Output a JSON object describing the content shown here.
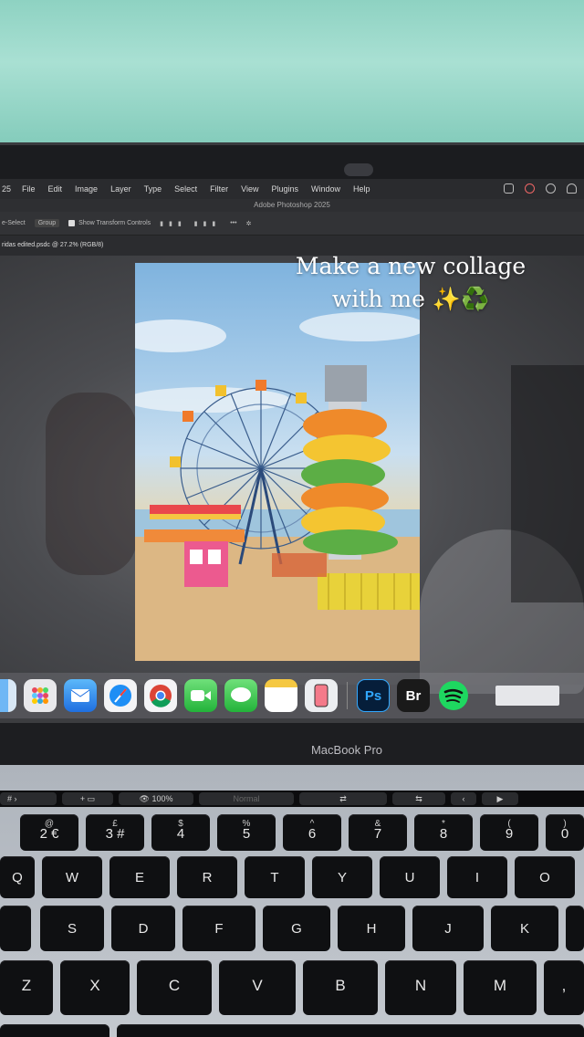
{
  "menubar": {
    "app_short": "25",
    "items": [
      "File",
      "Edit",
      "Image",
      "Layer",
      "Type",
      "Select",
      "Filter",
      "View",
      "Plugins",
      "Window",
      "Help"
    ]
  },
  "app_title": "Adobe Photoshop 2025",
  "options_bar": {
    "autoselect": "e-Select",
    "group": "Group",
    "transform": "Show Transform Controls",
    "more": "•••"
  },
  "document_tab": "ridas edited.psdc @ 27.2% (RGB/8)",
  "caption": {
    "line1": "Make a new collage",
    "line2": "with me ✨♻️"
  },
  "dock": {
    "apps": [
      {
        "name": "finder",
        "label": ""
      },
      {
        "name": "launchpad",
        "label": ""
      },
      {
        "name": "mail",
        "label": ""
      },
      {
        "name": "safari",
        "label": ""
      },
      {
        "name": "chrome",
        "label": ""
      },
      {
        "name": "facetime",
        "label": ""
      },
      {
        "name": "messages",
        "label": ""
      },
      {
        "name": "notes",
        "label": ""
      },
      {
        "name": "iphone-mirroring",
        "label": ""
      },
      {
        "name": "photoshop",
        "label": "Ps"
      },
      {
        "name": "bridge",
        "label": "Br"
      },
      {
        "name": "spotify",
        "label": ""
      }
    ]
  },
  "laptop_brand": "MacBook Pro",
  "touchbar": {
    "item1": "#",
    "item2": "+",
    "zoom": "100%",
    "blend": "Normal"
  },
  "keyboard": {
    "number_row": [
      {
        "top": "@",
        "main": "2 €"
      },
      {
        "top": "£",
        "main": "3 #"
      },
      {
        "top": "$",
        "main": "4"
      },
      {
        "top": "%",
        "main": "5"
      },
      {
        "top": "^",
        "main": "6"
      },
      {
        "top": "&",
        "main": "7"
      },
      {
        "top": "*",
        "main": "8"
      },
      {
        "top": "(",
        "main": "9"
      },
      {
        "top": ")",
        "main": "0"
      }
    ],
    "row_q": [
      "Q",
      "W",
      "E",
      "R",
      "T",
      "Y",
      "U",
      "I",
      "O"
    ],
    "row_a": [
      "",
      "S",
      "D",
      "F",
      "G",
      "H",
      "J",
      "K",
      "L"
    ],
    "row_z": [
      "Z",
      "X",
      "C",
      "V",
      "B",
      "N",
      "M",
      ","
    ]
  }
}
